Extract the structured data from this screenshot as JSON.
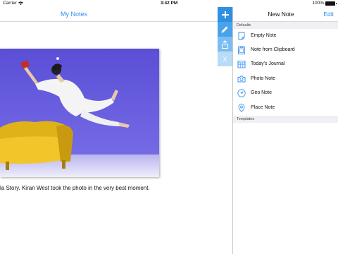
{
  "status_bar": {
    "carrier": "Carrier",
    "time": "3:42 PM",
    "battery": "100%"
  },
  "notes_pane": {
    "title": "My Notes",
    "caption": "la Story. Kiran West took the photo in the very best moment."
  },
  "toolbar": {
    "icons": [
      "plus-icon",
      "pencil-icon",
      "share-icon",
      "close-icon"
    ],
    "close_label": "X"
  },
  "new_note_pane": {
    "title": "New Note",
    "edit_label": "Edit",
    "sections": {
      "defaults": "Defaults",
      "templates": "Templates"
    },
    "items": [
      {
        "label": "Empty Note",
        "icon": "note-icon"
      },
      {
        "label": "Note from Clipboard",
        "icon": "clipboard-icon"
      },
      {
        "label": "Today's Journal",
        "icon": "calendar-icon"
      },
      {
        "label": "Photo Note",
        "icon": "camera-icon"
      },
      {
        "label": "Geo Note",
        "icon": "location-arrow-icon"
      },
      {
        "label": "Place Note",
        "icon": "map-pin-icon"
      }
    ]
  },
  "colors": {
    "accent": "#2f8ff2",
    "toolbar_1": "#2f8fe0",
    "toolbar_2": "#48a3ec",
    "toolbar_3": "#7bbdf2",
    "toolbar_4": "#b7dbf8",
    "section_bg": "#efeff4"
  }
}
